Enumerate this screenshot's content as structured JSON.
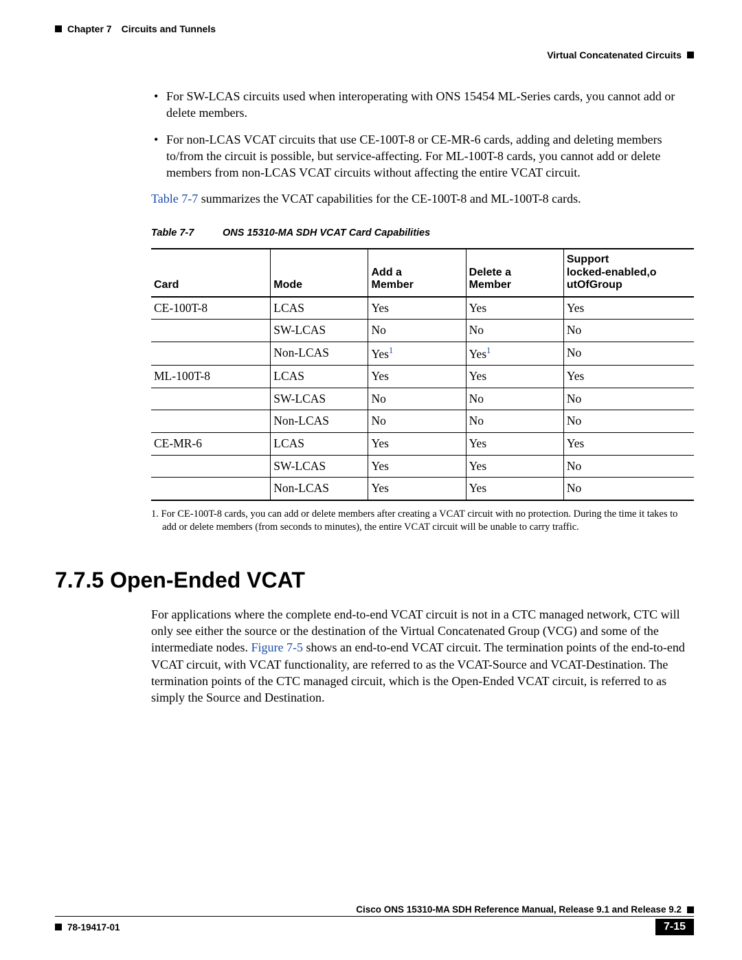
{
  "header": {
    "chapter_label": "Chapter 7",
    "chapter_title": "Circuits and Tunnels",
    "section_title": "Virtual Concatenated Circuits"
  },
  "bullets": [
    "For SW-LCAS circuits used when interoperating with ONS 15454 ML-Series cards, you cannot add or delete members.",
    "For non-LCAS VCAT circuits that use CE-100T-8 or CE-MR-6 cards, adding and deleting members to/from the circuit is possible, but service-affecting. For ML-100T-8 cards, you cannot add or delete members from non-LCAS VCAT circuits without affecting the entire VCAT circuit."
  ],
  "summary_sentence": {
    "link": "Table 7-7",
    "rest": " summarizes the VCAT capabilities for the CE-100T-8 and ML-100T-8 cards."
  },
  "table": {
    "caption_label": "Table 7-7",
    "caption_text": "ONS 15310-MA SDH VCAT Card Capabilities",
    "headers": {
      "card": "Card",
      "mode": "Mode",
      "add": "Add a Member",
      "del": "Delete a Member",
      "sup": "Support locked-enabled,outOfGroup"
    },
    "rows": [
      {
        "card": "CE-100T-8",
        "mode": "LCAS",
        "add": "Yes",
        "del": "Yes",
        "sup": "Yes",
        "add_fn": false,
        "del_fn": false
      },
      {
        "card": "",
        "mode": "SW-LCAS",
        "add": "No",
        "del": "No",
        "sup": "No",
        "add_fn": false,
        "del_fn": false
      },
      {
        "card": "",
        "mode": "Non-LCAS",
        "add": "Yes",
        "del": "Yes",
        "sup": "No",
        "add_fn": true,
        "del_fn": true
      },
      {
        "card": "ML-100T-8",
        "mode": "LCAS",
        "add": "Yes",
        "del": "Yes",
        "sup": "Yes",
        "add_fn": false,
        "del_fn": false
      },
      {
        "card": "",
        "mode": "SW-LCAS",
        "add": "No",
        "del": "No",
        "sup": "No",
        "add_fn": false,
        "del_fn": false
      },
      {
        "card": "",
        "mode": "Non-LCAS",
        "add": "No",
        "del": "No",
        "sup": "No",
        "add_fn": false,
        "del_fn": false
      },
      {
        "card": "CE-MR-6",
        "mode": "LCAS",
        "add": "Yes",
        "del": "Yes",
        "sup": "Yes",
        "add_fn": false,
        "del_fn": false
      },
      {
        "card": "",
        "mode": "SW-LCAS",
        "add": "Yes",
        "del": "Yes",
        "sup": "No",
        "add_fn": false,
        "del_fn": false
      },
      {
        "card": "",
        "mode": "Non-LCAS",
        "add": "Yes",
        "del": "Yes",
        "sup": "No",
        "add_fn": false,
        "del_fn": false
      }
    ],
    "footnote_marker": "1",
    "footnote": "For CE-100T-8 cards, you can add or delete members after creating a VCAT circuit with no protection. During the time it takes to add or delete members (from seconds to minutes), the entire VCAT circuit will be unable to carry traffic."
  },
  "section_heading": "7.7.5  Open-Ended VCAT",
  "section_body": {
    "pre_link": "For applications where the complete end-to-end VCAT circuit is not in a CTC managed network, CTC will only see either the source or the destination of the Virtual Concatenated Group (VCG) and some of the intermediate nodes. ",
    "link": "Figure 7-5",
    "post_link": " shows an end-to-end VCAT circuit. The termination points of the end-to-end VCAT circuit, with VCAT functionality, are referred to as the VCAT-Source and VCAT-Destination. The termination points of the CTC managed circuit, which is the Open-Ended VCAT circuit, is referred to as simply the Source and Destination."
  },
  "footer": {
    "manual": "Cisco ONS 15310-MA SDH Reference Manual, Release 9.1 and Release 9.2",
    "doc_no": "78-19417-01",
    "page": "7-15"
  }
}
